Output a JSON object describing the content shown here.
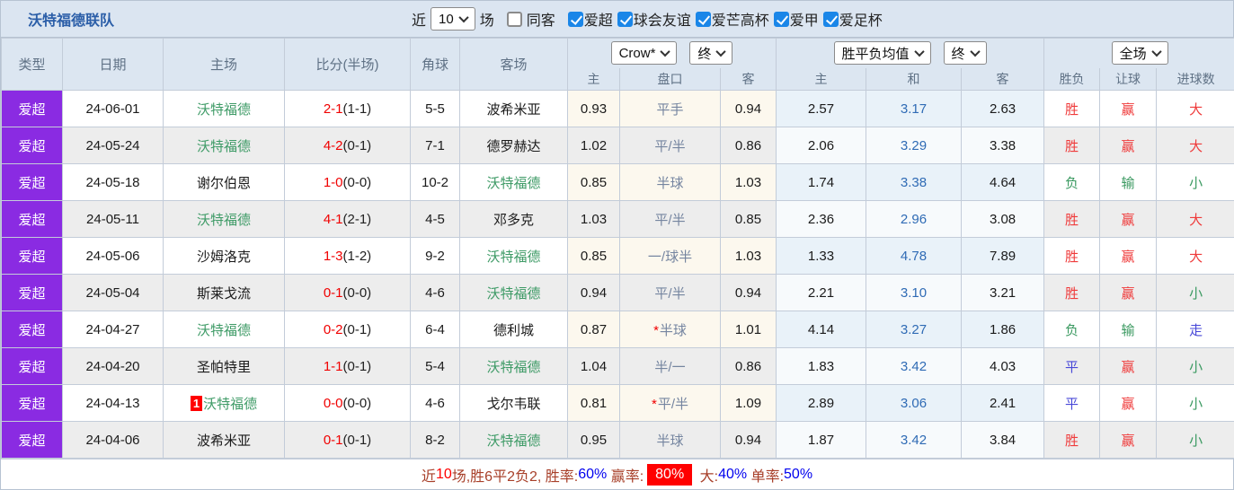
{
  "title": "沃特福德联队",
  "topbar": {
    "recent_label": "近",
    "recent_value": "10",
    "games_label": "场",
    "same_opponent": {
      "label": "同客",
      "checked": false
    },
    "leagues": [
      {
        "label": "爱超",
        "checked": true
      },
      {
        "label": "球会友谊",
        "checked": true
      },
      {
        "label": "爱芒高杯",
        "checked": true
      },
      {
        "label": "爱甲",
        "checked": true
      },
      {
        "label": "爱足杯",
        "checked": true
      }
    ]
  },
  "header": {
    "type": "类型",
    "date": "日期",
    "home": "主场",
    "score": "比分(半场)",
    "corner": "角球",
    "away": "客场",
    "odds_company_select": "Crow*",
    "odds_final_select": "终",
    "mean_select": "胜平负均值",
    "mean_final_select": "终",
    "period_select": "全场",
    "sub_home": "主",
    "sub_handicap": "盘口",
    "sub_away": "客",
    "sub_mean_home": "主",
    "sub_mean_draw": "和",
    "sub_mean_away": "客",
    "sub_wdl": "胜负",
    "sub_let": "让球",
    "sub_goals": "进球数"
  },
  "rows": [
    {
      "league": "爱超",
      "date": "24-06-01",
      "badge": "",
      "home": "沃特福德",
      "home_self": true,
      "score": "2-1",
      "half": "(1-1)",
      "corner": "5-5",
      "away": "波希米亚",
      "away_self": false,
      "crow_home": "0.93",
      "handicap_star": "",
      "handicap": "平手",
      "crow_away": "0.94",
      "mean_home": "2.57",
      "mean_draw": "3.17",
      "mean_away": "2.63",
      "wdl": "胜",
      "wdl_color": "red",
      "let": "赢",
      "let_color": "red",
      "goals": "大",
      "goals_color": "red"
    },
    {
      "league": "爱超",
      "date": "24-05-24",
      "badge": "",
      "home": "沃特福德",
      "home_self": true,
      "score": "4-2",
      "half": "(0-1)",
      "corner": "7-1",
      "away": "德罗赫达",
      "away_self": false,
      "crow_home": "1.02",
      "handicap_star": "",
      "handicap": "平/半",
      "crow_away": "0.86",
      "mean_home": "2.06",
      "mean_draw": "3.29",
      "mean_away": "3.38",
      "wdl": "胜",
      "wdl_color": "red",
      "let": "赢",
      "let_color": "red",
      "goals": "大",
      "goals_color": "red"
    },
    {
      "league": "爱超",
      "date": "24-05-18",
      "badge": "",
      "home": "谢尔伯恩",
      "home_self": false,
      "score": "1-0",
      "half": "(0-0)",
      "corner": "10-2",
      "away": "沃特福德",
      "away_self": true,
      "crow_home": "0.85",
      "handicap_star": "",
      "handicap": "半球",
      "crow_away": "1.03",
      "mean_home": "1.74",
      "mean_draw": "3.38",
      "mean_away": "4.64",
      "wdl": "负",
      "wdl_color": "green",
      "let": "输",
      "let_color": "green",
      "goals": "小",
      "goals_color": "green"
    },
    {
      "league": "爱超",
      "date": "24-05-11",
      "badge": "",
      "home": "沃特福德",
      "home_self": true,
      "score": "4-1",
      "half": "(2-1)",
      "corner": "4-5",
      "away": "邓多克",
      "away_self": false,
      "crow_home": "1.03",
      "handicap_star": "",
      "handicap": "平/半",
      "crow_away": "0.85",
      "mean_home": "2.36",
      "mean_draw": "2.96",
      "mean_away": "3.08",
      "wdl": "胜",
      "wdl_color": "red",
      "let": "赢",
      "let_color": "red",
      "goals": "大",
      "goals_color": "red"
    },
    {
      "league": "爱超",
      "date": "24-05-06",
      "badge": "",
      "home": "沙姆洛克",
      "home_self": false,
      "score": "1-3",
      "half": "(1-2)",
      "corner": "9-2",
      "away": "沃特福德",
      "away_self": true,
      "crow_home": "0.85",
      "handicap_star": "",
      "handicap": "一/球半",
      "crow_away": "1.03",
      "mean_home": "1.33",
      "mean_draw": "4.78",
      "mean_away": "7.89",
      "wdl": "胜",
      "wdl_color": "red",
      "let": "赢",
      "let_color": "red",
      "goals": "大",
      "goals_color": "red"
    },
    {
      "league": "爱超",
      "date": "24-05-04",
      "badge": "",
      "home": "斯莱戈流",
      "home_self": false,
      "score": "0-1",
      "half": "(0-0)",
      "corner": "4-6",
      "away": "沃特福德",
      "away_self": true,
      "crow_home": "0.94",
      "handicap_star": "",
      "handicap": "平/半",
      "crow_away": "0.94",
      "mean_home": "2.21",
      "mean_draw": "3.10",
      "mean_away": "3.21",
      "wdl": "胜",
      "wdl_color": "red",
      "let": "赢",
      "let_color": "red",
      "goals": "小",
      "goals_color": "green"
    },
    {
      "league": "爱超",
      "date": "24-04-27",
      "badge": "",
      "home": "沃特福德",
      "home_self": true,
      "score": "0-2",
      "half": "(0-1)",
      "corner": "6-4",
      "away": "德利城",
      "away_self": false,
      "crow_home": "0.87",
      "handicap_star": "*",
      "handicap": "半球",
      "crow_away": "1.01",
      "mean_home": "4.14",
      "mean_draw": "3.27",
      "mean_away": "1.86",
      "wdl": "负",
      "wdl_color": "green",
      "let": "输",
      "let_color": "green",
      "goals": "走",
      "goals_color": "blue"
    },
    {
      "league": "爱超",
      "date": "24-04-20",
      "badge": "",
      "home": "圣帕特里",
      "home_self": false,
      "score": "1-1",
      "half": "(0-1)",
      "corner": "5-4",
      "away": "沃特福德",
      "away_self": true,
      "crow_home": "1.04",
      "handicap_star": "",
      "handicap": "半/一",
      "crow_away": "0.86",
      "mean_home": "1.83",
      "mean_draw": "3.42",
      "mean_away": "4.03",
      "wdl": "平",
      "wdl_color": "blue",
      "let": "赢",
      "let_color": "red",
      "goals": "小",
      "goals_color": "green"
    },
    {
      "league": "爱超",
      "date": "24-04-13",
      "badge": "1",
      "home": "沃特福德",
      "home_self": true,
      "score": "0-0",
      "half": "(0-0)",
      "corner": "4-6",
      "away": "戈尔韦联",
      "away_self": false,
      "crow_home": "0.81",
      "handicap_star": "*",
      "handicap": "平/半",
      "crow_away": "1.09",
      "mean_home": "2.89",
      "mean_draw": "3.06",
      "mean_away": "2.41",
      "wdl": "平",
      "wdl_color": "blue",
      "let": "赢",
      "let_color": "red",
      "goals": "小",
      "goals_color": "green"
    },
    {
      "league": "爱超",
      "date": "24-04-06",
      "badge": "",
      "home": "波希米亚",
      "home_self": false,
      "score": "0-1",
      "half": "(0-1)",
      "corner": "8-2",
      "away": "沃特福德",
      "away_self": true,
      "crow_home": "0.95",
      "handicap_star": "",
      "handicap": "半球",
      "crow_away": "0.94",
      "mean_home": "1.87",
      "mean_draw": "3.42",
      "mean_away": "3.84",
      "wdl": "胜",
      "wdl_color": "red",
      "let": "赢",
      "let_color": "red",
      "goals": "小",
      "goals_color": "green"
    }
  ],
  "footer": {
    "segments": [
      {
        "text": "近",
        "style": "label"
      },
      {
        "text": "10",
        "style": "red"
      },
      {
        "text": "场,胜6平2负2, 胜率:",
        "style": "label"
      },
      {
        "text": "60%",
        "style": "blue"
      },
      {
        "text": " 赢率:",
        "style": "label"
      },
      {
        "text": "80%",
        "style": "highlight"
      },
      {
        "text": " 大:",
        "style": "label"
      },
      {
        "text": "40%",
        "style": "blue"
      },
      {
        "text": " 单率:",
        "style": "label"
      },
      {
        "text": "50%",
        "style": "blue"
      }
    ]
  }
}
